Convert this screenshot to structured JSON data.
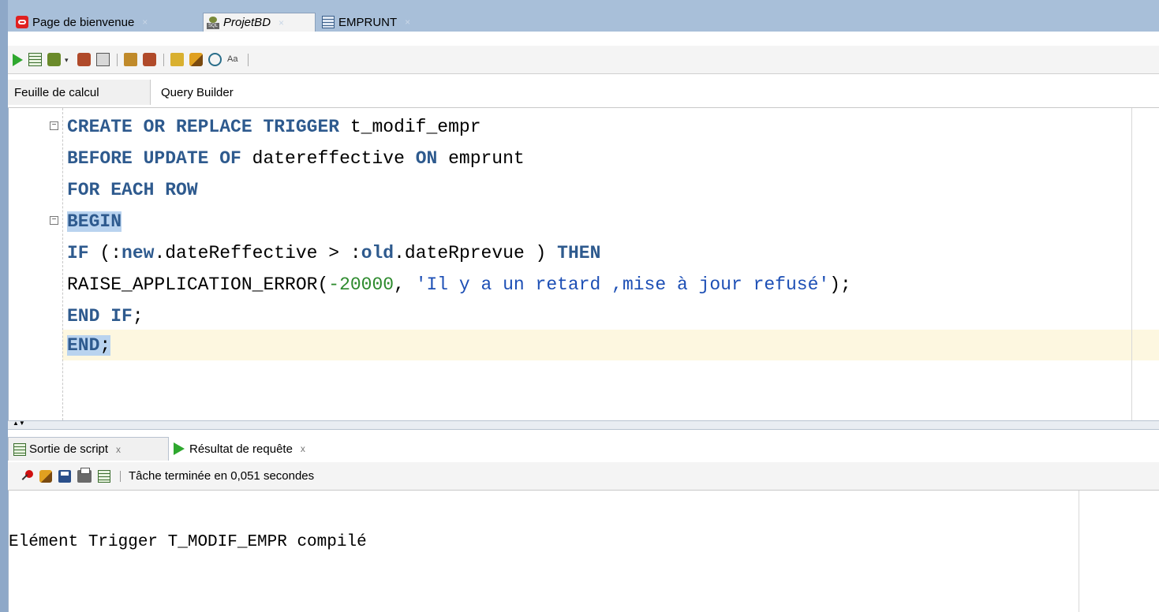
{
  "doc_tabs": [
    {
      "label": "Page de bienvenue",
      "icon": "oracle-icon",
      "active": false
    },
    {
      "label": "ProjetBD",
      "icon": "database-connection-icon",
      "active": true
    },
    {
      "label": "EMPRUNT",
      "icon": "table-icon",
      "active": false
    }
  ],
  "close_glyph": "×",
  "worksheet_tabs": {
    "active": "Feuille de calcul",
    "inactive": "Query Builder"
  },
  "editor": {
    "lines": [
      {
        "kw1": "CREATE OR REPLACE TRIGGER",
        "rest": " t_modif_empr"
      },
      {
        "kw1": "BEFORE UPDATE OF",
        "mid": " datereffective ",
        "kw2": "ON",
        "rest": " emprunt"
      },
      {
        "kw1": "FOR EACH ROW"
      },
      {
        "kw1": "BEGIN"
      },
      {
        "kw1": "IF",
        "p1": " (:",
        "kw2": "new",
        "p2": ".dateReffective > :",
        "kw3": "old",
        "p3": ".dateRprevue ) ",
        "kw4": "THEN"
      },
      {
        "p1": "RAISE_APPLICATION_ERROR(",
        "num": "-20000",
        "p2": ", ",
        "str": "'Il y a un retard ,mise à jour refusé'",
        "p3": ");"
      },
      {
        "kw1": "END IF",
        "p1": ";"
      },
      {
        "kw1": "END",
        "p1": ";"
      }
    ]
  },
  "output_tabs": [
    {
      "label": "Sortie de script",
      "active": true
    },
    {
      "label": "Résultat de requête",
      "active": false
    }
  ],
  "output_close_glyph": "x",
  "output_toolbar": {
    "status": "Tâche terminée en 0,051 secondes"
  },
  "output": {
    "message": "Elément Trigger T_MODIF_EMPR compilé"
  }
}
